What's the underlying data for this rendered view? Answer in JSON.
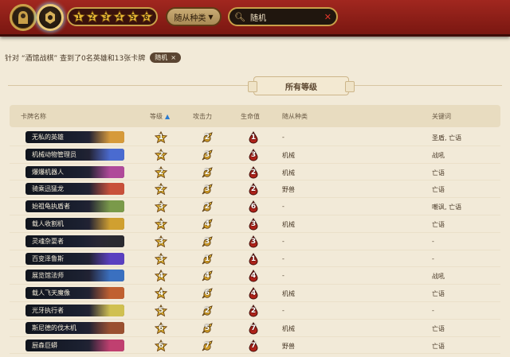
{
  "toolbar": {
    "star_tiers": [
      "1",
      "2",
      "3",
      "4",
      "5",
      "6"
    ],
    "minion_type_label": "随从种类",
    "search": {
      "value": "随机",
      "placeholder": ""
    }
  },
  "result": {
    "text": "针对 “酒馆战棋” 查到了0名英雄和13张卡牌",
    "filter_chip": "随机",
    "filter_chip_close": "×"
  },
  "banner": {
    "label": "所有等级"
  },
  "table": {
    "headers": {
      "name": "卡牌名称",
      "tier": "等级",
      "attack": "攻击力",
      "health": "生命值",
      "tribe": "随从种类",
      "keywords": "关键词"
    },
    "rows": [
      {
        "name": "无私的英雄",
        "tier": "1",
        "attack": "2",
        "health": "1",
        "tribe": "-",
        "keywords": "圣盾, 亡语"
      },
      {
        "name": "机械动物管理员",
        "tier": "2",
        "attack": "3",
        "health": "3",
        "tribe": "机械",
        "keywords": "战吼"
      },
      {
        "name": "爆爆机器人",
        "tier": "2",
        "attack": "2",
        "health": "2",
        "tribe": "机械",
        "keywords": "亡语"
      },
      {
        "name": "骑乘迅猛龙",
        "tier": "2",
        "attack": "3",
        "health": "2",
        "tribe": "野兽",
        "keywords": "亡语"
      },
      {
        "name": "始祖龟执盾者",
        "tier": "3",
        "attack": "2",
        "health": "6",
        "tribe": "-",
        "keywords": "嘲讽, 亡语"
      },
      {
        "name": "载人收割机",
        "tier": "3",
        "attack": "4",
        "health": "3",
        "tribe": "机械",
        "keywords": "亡语"
      },
      {
        "name": "灵魂杂耍者",
        "tier": "3",
        "attack": "3",
        "health": "3",
        "tribe": "-",
        "keywords": "-"
      },
      {
        "name": "百变泽鲁斯",
        "tier": "3",
        "attack": "1",
        "health": "1",
        "tribe": "-",
        "keywords": "-"
      },
      {
        "name": "展览馆法师",
        "tier": "4",
        "attack": "4",
        "health": "4",
        "tribe": "-",
        "keywords": "战吼"
      },
      {
        "name": "载人飞天魔像",
        "tier": "4",
        "attack": "6",
        "health": "4",
        "tribe": "机械",
        "keywords": "亡语"
      },
      {
        "name": "光牙执行者",
        "tier": "5",
        "attack": "2",
        "health": "2",
        "tribe": "-",
        "keywords": "-"
      },
      {
        "name": "斯尼德的伐木机",
        "tier": "6",
        "attack": "5",
        "health": "7",
        "tribe": "机械",
        "keywords": "亡语"
      },
      {
        "name": "厨森巨蟒",
        "tier": "6",
        "attack": "7",
        "health": "7",
        "tribe": "野兽",
        "keywords": "亡语"
      }
    ]
  },
  "colors": {
    "topbar_red": "#8f2019",
    "gold_frame": "#c9a048",
    "tier_star": "#e6b735",
    "attack_yellow": "#e6b735",
    "health_red": "#b0231a",
    "search_clear": "#e0362b",
    "sort_arrow": "#2a7ad0"
  },
  "icons": {
    "left_circle": "hero-icon",
    "right_circle": "minion-icon",
    "search": "search-icon",
    "clear": "close-icon",
    "tier": "star-icon",
    "attack": "sword-icon",
    "health": "blood-drop-icon"
  }
}
